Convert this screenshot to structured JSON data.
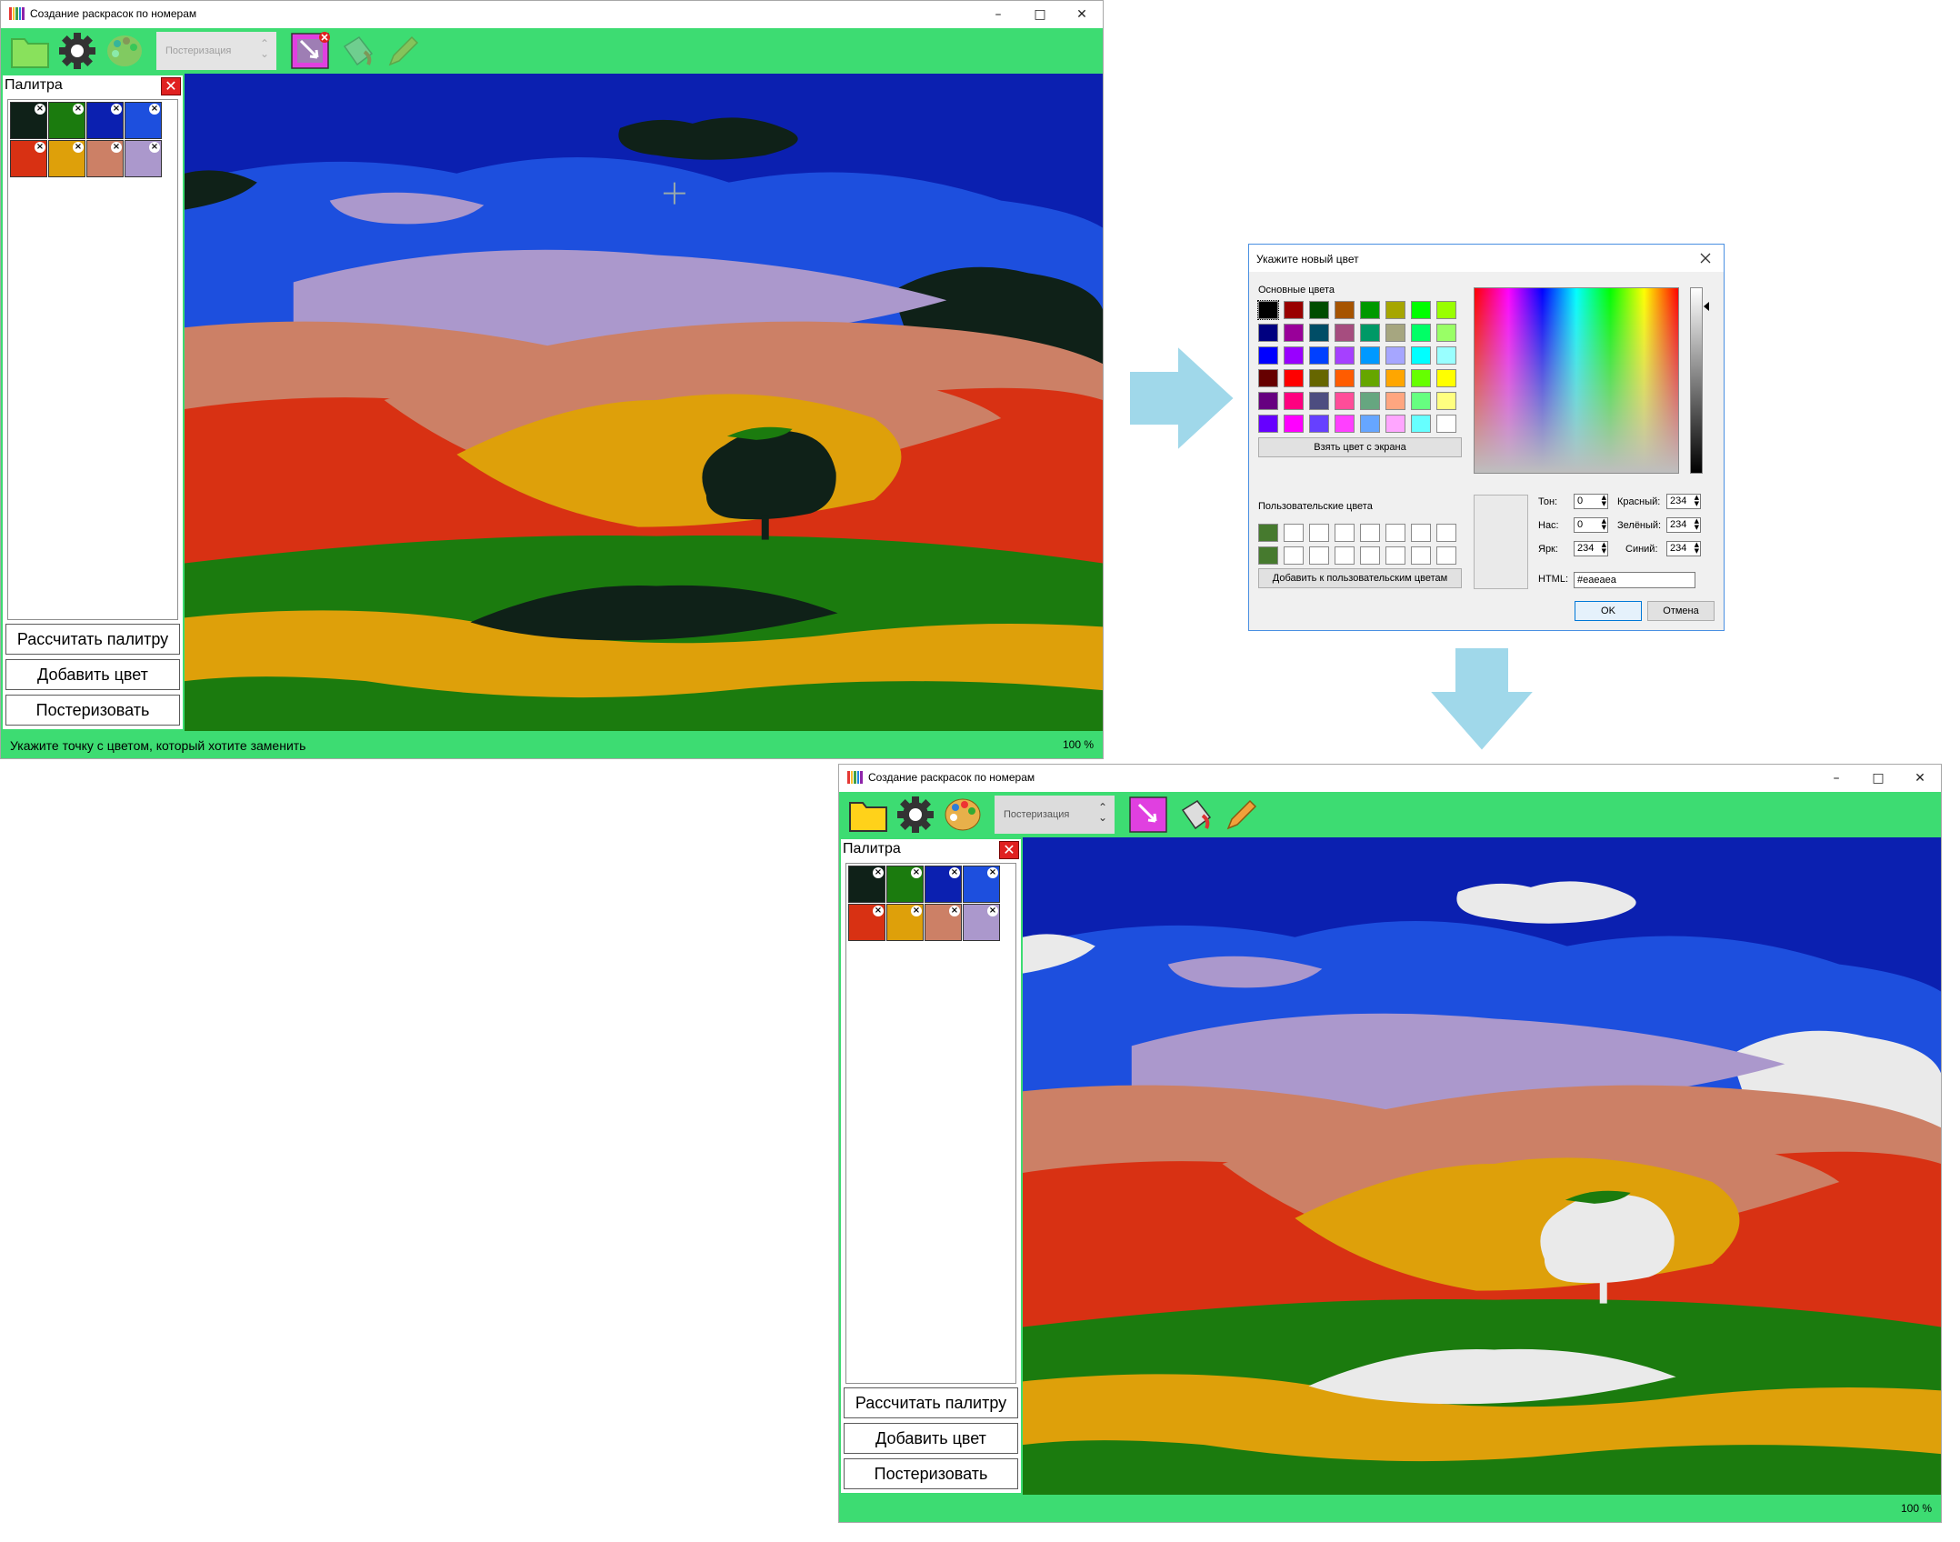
{
  "window1": {
    "title": "Создание раскрасок по номерам",
    "posterize_label": "Постеризация",
    "panel_title": "Палитра",
    "buttons": {
      "calc": "Рассчитать палитру",
      "add": "Добавить цвет",
      "posterize": "Постеризовать"
    },
    "status_text": "Укажите точку с цветом, который хотите заменить",
    "zoom": "100 %"
  },
  "window2": {
    "title": "Создание раскрасок по номерам",
    "posterize_label": "Постеризация",
    "panel_title": "Палитра",
    "buttons": {
      "calc": "Рассчитать палитру",
      "add": "Добавить цвет",
      "posterize": "Постеризовать"
    },
    "status_text": "",
    "zoom": "100 %"
  },
  "palette": [
    "#0f2118",
    "#1b7b0e",
    "#0b20b0",
    "#1d4fde",
    "#d83113",
    "#dea00a",
    "#cc8066",
    "#ab98cc"
  ],
  "replacement_color": "#eaeaea",
  "dialog": {
    "title": "Укажите новый цвет",
    "basic_label": "Основные цвета",
    "pick_screen": "Взять цвет с экрана",
    "custom_label": "Пользовательские цвета",
    "add_custom": "Добавить к пользовательским цветам",
    "hue_label": "Тон:",
    "sat_label": "Нас:",
    "val_label": "Ярк:",
    "red_label": "Красный:",
    "green_label": "Зелёный:",
    "blue_label": "Синий:",
    "hue": "0",
    "sat": "0",
    "val": "234",
    "red": "234",
    "green": "234",
    "blue": "234",
    "html_label": "HTML:",
    "html_value": "#eaeaea",
    "ok": "OK",
    "cancel": "Отмена",
    "basic_colors": [
      "#000000",
      "#990000",
      "#004d00",
      "#a65400",
      "#009900",
      "#a6a600",
      "#00ff00",
      "#99ff00",
      "#000080",
      "#990099",
      "#004d66",
      "#a64d7f",
      "#009966",
      "#a6a680",
      "#00ff66",
      "#99ff66",
      "#0000ff",
      "#9900ff",
      "#0040ff",
      "#a640ff",
      "#0099ff",
      "#a6a6ff",
      "#00ffff",
      "#99ffff",
      "#660000",
      "#ff0000",
      "#666600",
      "#ff5c00",
      "#66a600",
      "#ffa600",
      "#66ff00",
      "#ffff00",
      "#660080",
      "#ff0080",
      "#4d4d80",
      "#ff4d99",
      "#66a680",
      "#ffa680",
      "#66ff80",
      "#ffff80",
      "#6600ff",
      "#ff00ff",
      "#6640ff",
      "#ff40ff",
      "#66a6ff",
      "#ffa6ff",
      "#66ffff",
      "#ffffff"
    ],
    "custom_colors": [
      "#467a2e",
      "#ffffff",
      "#ffffff",
      "#ffffff",
      "#ffffff",
      "#ffffff",
      "#ffffff",
      "#ffffff",
      "#467a2e",
      "#ffffff",
      "#ffffff",
      "#ffffff",
      "#ffffff",
      "#ffffff",
      "#ffffff",
      "#ffffff"
    ]
  }
}
